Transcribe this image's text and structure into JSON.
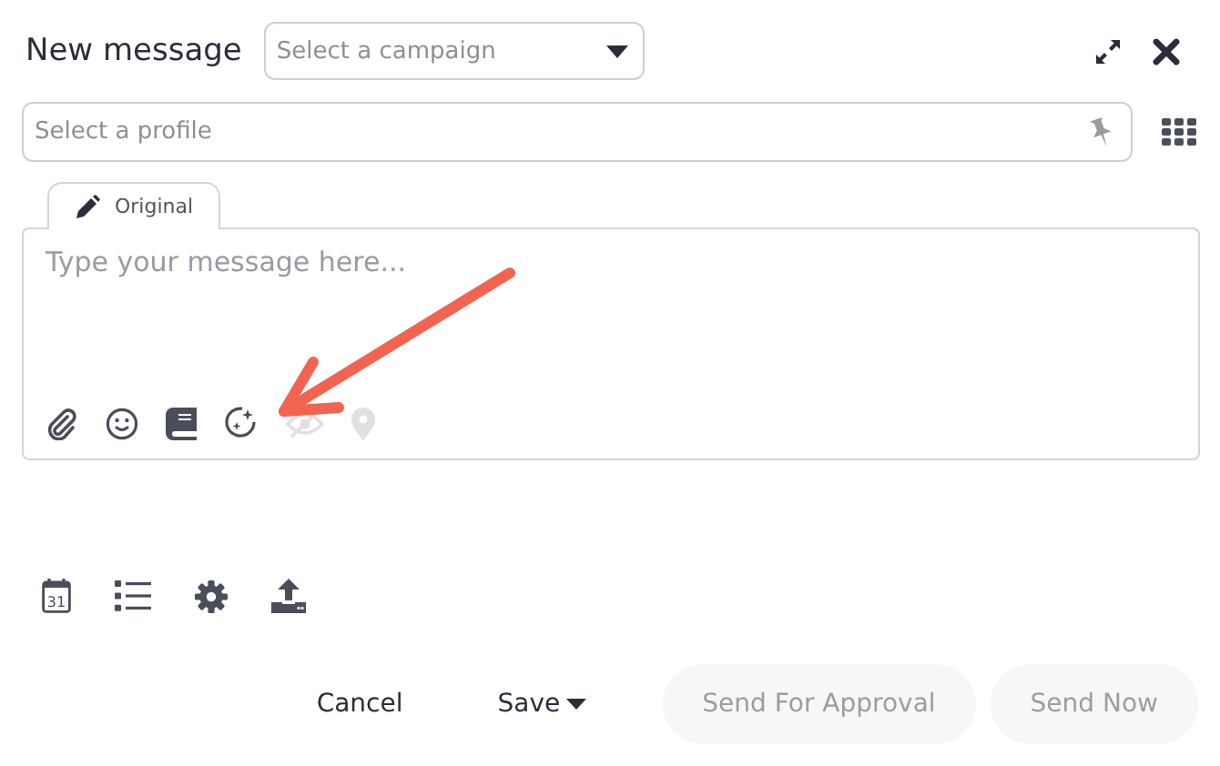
{
  "header": {
    "title": "New message",
    "campaign_select": {
      "placeholder": "Select a campaign"
    }
  },
  "profile_field": {
    "placeholder": "Select a profile"
  },
  "tabs": [
    {
      "label": "Original",
      "selected": true
    }
  ],
  "editor": {
    "placeholder": "Type your message here...",
    "tools": [
      {
        "kind": "attach",
        "disabled": false
      },
      {
        "kind": "emoji",
        "disabled": false
      },
      {
        "kind": "book",
        "disabled": false
      },
      {
        "kind": "ai",
        "disabled": false
      },
      {
        "kind": "preview",
        "disabled": true
      },
      {
        "kind": "location",
        "disabled": true
      }
    ]
  },
  "options": [
    {
      "kind": "calendar",
      "text": "31"
    },
    {
      "kind": "list"
    },
    {
      "kind": "settings"
    },
    {
      "kind": "upload"
    }
  ],
  "buttons": [
    {
      "label": "Cancel",
      "kind": "plain",
      "disabled": false
    },
    {
      "label": "Save",
      "kind": "menu",
      "disabled": false
    },
    {
      "label": "Send For Approval",
      "kind": "pill",
      "disabled": true
    },
    {
      "label": "Send Now",
      "kind": "pill",
      "disabled": true
    }
  ]
}
